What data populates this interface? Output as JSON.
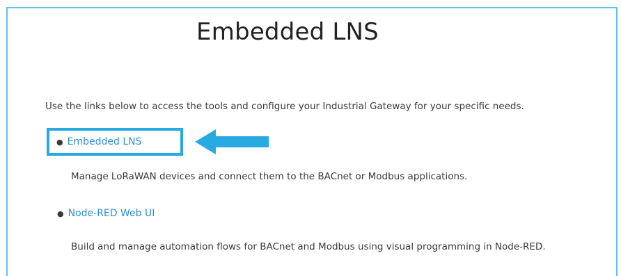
{
  "page": {
    "title": "Embedded LNS",
    "intro": "Use the links below to access the tools and configure your Industrial Gateway for your specific needs."
  },
  "links": [
    {
      "label": "Embedded LNS",
      "description": "Manage LoRaWAN devices and connect them to the BACnet or Modbus applications."
    },
    {
      "label": "Node-RED Web UI",
      "description": "Build and manage automation flows for BACnet and Modbus using visual programming in Node-RED."
    }
  ],
  "colors": {
    "frame_border": "#5ec2e8",
    "highlight": "#27a9e1",
    "link": "#2f8fd6",
    "text": "#3a3a3a"
  },
  "icons": {
    "bullet": "bullet-icon",
    "callout_arrow": "left-arrow-icon"
  }
}
